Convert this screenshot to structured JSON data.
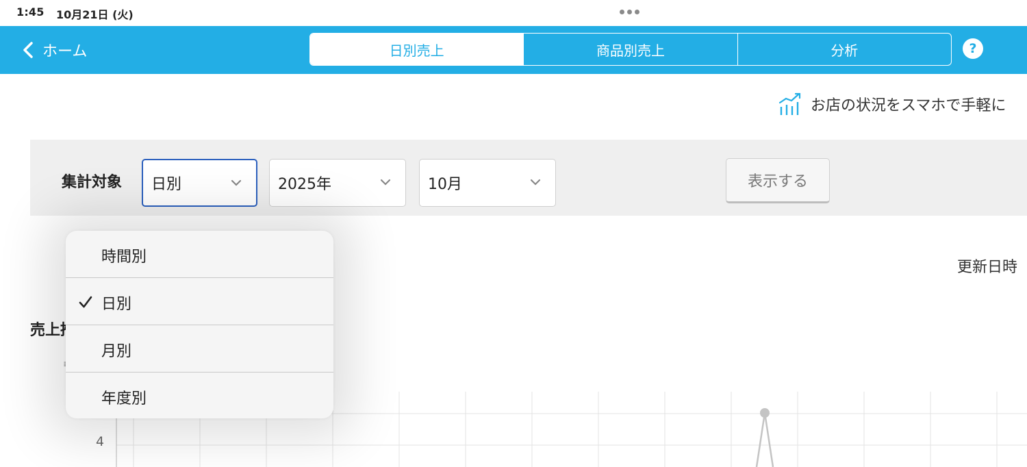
{
  "status": {
    "time": "1:45",
    "date": "10月21日 (火)"
  },
  "nav": {
    "back_label": "ホーム",
    "tabs": [
      {
        "label": "日別売上",
        "selected": true
      },
      {
        "label": "商品別売上",
        "selected": false
      },
      {
        "label": "分析",
        "selected": false
      }
    ],
    "help_label": "?"
  },
  "promo": {
    "text": "お店の状況をスマホで手軽に"
  },
  "filter": {
    "label": "集計対象",
    "period": "日別",
    "year": "2025年",
    "month": "10月",
    "show_button": "表示する"
  },
  "updated_label": "更新日時",
  "section_title": "売上推移",
  "chart": {
    "tick_label": "4"
  },
  "dropdown": {
    "options": [
      {
        "label": "時間別",
        "checked": false
      },
      {
        "label": "日別",
        "checked": true
      },
      {
        "label": "月別",
        "checked": false
      },
      {
        "label": "年度別",
        "checked": false
      }
    ]
  },
  "colors": {
    "accent": "#23aee5",
    "focus": "#2a5fbd"
  }
}
